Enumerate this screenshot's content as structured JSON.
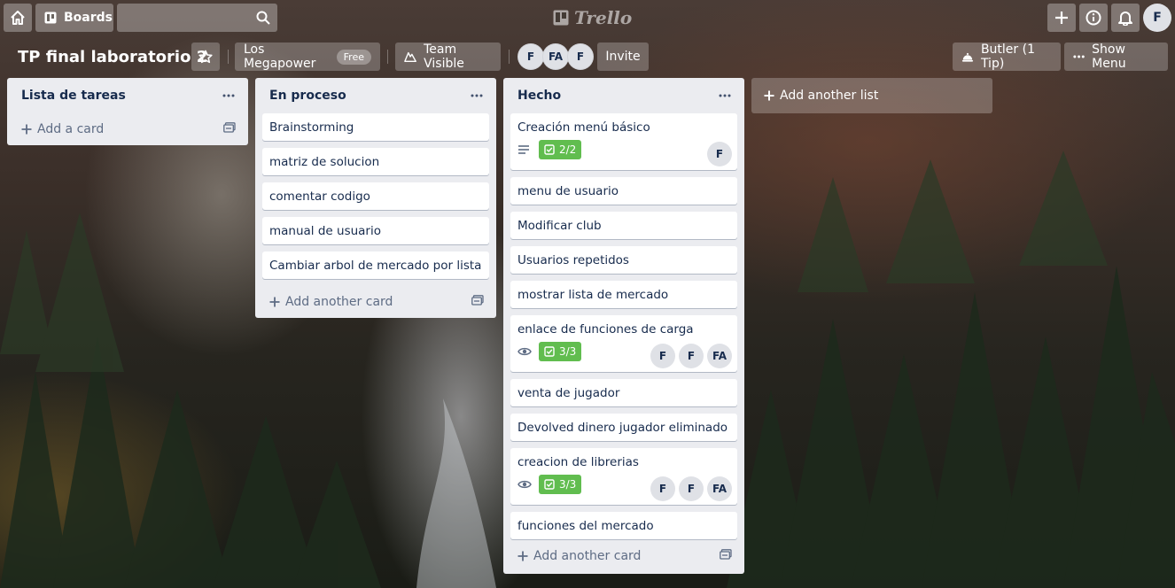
{
  "topbar": {
    "boards_label": "Boards",
    "search_value": "",
    "logo_text": "Trello",
    "profile_initial": "F"
  },
  "board": {
    "title": "TP final laboratorio 2",
    "team_name": "Los Megapower",
    "team_badge": "Free",
    "visibility_label": "Team Visible",
    "members": [
      "F",
      "FA",
      "F"
    ],
    "invite_label": "Invite",
    "butler_label": "Butler (1 Tip)",
    "menu_label": "Show Menu"
  },
  "lists": [
    {
      "title": "Lista de tareas",
      "cards": [],
      "add_label": "Add a card"
    },
    {
      "title": "En proceso",
      "cards": [
        {
          "title": "Brainstorming"
        },
        {
          "title": "matriz de solucion"
        },
        {
          "title": "comentar codigo"
        },
        {
          "title": "manual de usuario"
        },
        {
          "title": "Cambiar arbol de mercado por lista"
        }
      ],
      "add_label": "Add another card"
    },
    {
      "title": "Hecho",
      "cards": [
        {
          "title": "Creación menú básico",
          "description_icon": "description-icon",
          "checklist": "2/2",
          "members": [
            "F"
          ]
        },
        {
          "title": "menu de usuario"
        },
        {
          "title": "Modificar club"
        },
        {
          "title": "Usuarios repetidos"
        },
        {
          "title": "mostrar lista de mercado"
        },
        {
          "title": "enlace de funciones de carga",
          "watch_icon": "eye-icon",
          "checklist": "3/3",
          "members": [
            "F",
            "F",
            "FA"
          ]
        },
        {
          "title": "venta de jugador"
        },
        {
          "title": "Devolved dinero jugador eliminado"
        },
        {
          "title": "creacion de librerias",
          "watch_icon": "eye-icon",
          "checklist": "3/3",
          "members": [
            "F",
            "F",
            "FA"
          ]
        },
        {
          "title": "funciones del mercado"
        }
      ],
      "add_label": "Add another card"
    }
  ],
  "add_list_label": "Add another list",
  "colors": {
    "list_bg": "#ebecf0",
    "card_text": "#172b4d",
    "checklist_complete": "#61bd4f",
    "muted": "#5e6c84"
  }
}
